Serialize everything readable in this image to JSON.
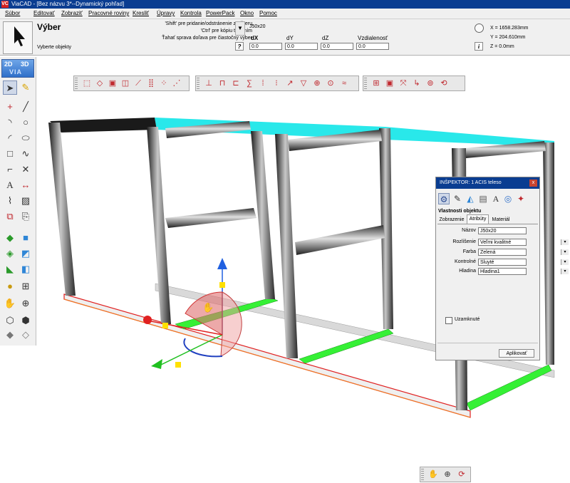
{
  "window": {
    "app_logo": "VC",
    "title": "ViaCAD - [Bez názvu 3*--Dynamický pohľad]"
  },
  "menu": [
    "Súbor",
    "Editovať",
    "Zobraziť",
    "Pracovné roviny",
    "Kresliť",
    "Úpravy",
    "Kontrola",
    "PowerPack",
    "Okno",
    "Pomoc"
  ],
  "command_panel": {
    "tool_name": "Výber",
    "prompt": "Vyberte objekty",
    "hint_lines": [
      "'Shift' pre pridanie/odstránenie z výberu",
      "'Ctrl' pre kópiu ťahaním",
      "Ťahať sprava doľava pre čiastočný výber"
    ],
    "object_name": "J50x20",
    "dx_label": "dX",
    "dy_label": "dY",
    "dz_label": "dZ",
    "distance_label": "Vzdialenosť",
    "dx_value": "0.0",
    "dy_value": "0.0",
    "dz_value": "0.0",
    "distance_value": "0.0",
    "help_glyph": "?",
    "info_glyph": "i",
    "coords": {
      "x": "X  =  1658.283mm",
      "y": "Y  =  204.610mm",
      "z": "Z  =  0.0mm"
    }
  },
  "palette": {
    "mode_2d": "2D",
    "mode_3d": "3D",
    "mode_via": "VIA"
  },
  "inspector": {
    "title": "INŠPEKTOR:  1 ACIS teleso",
    "close_glyph": "x",
    "section_title": "Vlastnosti objektu",
    "tabs": [
      "Zobrazenie",
      "Atribúty",
      "Materiál"
    ],
    "active_tab": "Atribúty",
    "properties": [
      {
        "label": "Názov",
        "value": "J50x20",
        "dropdown": false
      },
      {
        "label": "Rozlíšenie",
        "value": "Veľmi kvalitné",
        "dropdown": true
      },
      {
        "label": "Farba",
        "value": "Zelená",
        "dropdown": true
      },
      {
        "label": "Kontrolné",
        "value": "Sluyté",
        "dropdown": true
      },
      {
        "label": "Hladina",
        "value": "Hladina1",
        "dropdown": true
      }
    ],
    "locked_label": "Uzamknuté",
    "locked": false,
    "apply_label": "Aplikovať"
  },
  "colors": {
    "title_bar": "#0a3d91",
    "selection_green": "#35f035",
    "highlight_red": "#e02020",
    "panel_cyan": "#29e8ea",
    "beam_dark": "#2a2a2a"
  }
}
